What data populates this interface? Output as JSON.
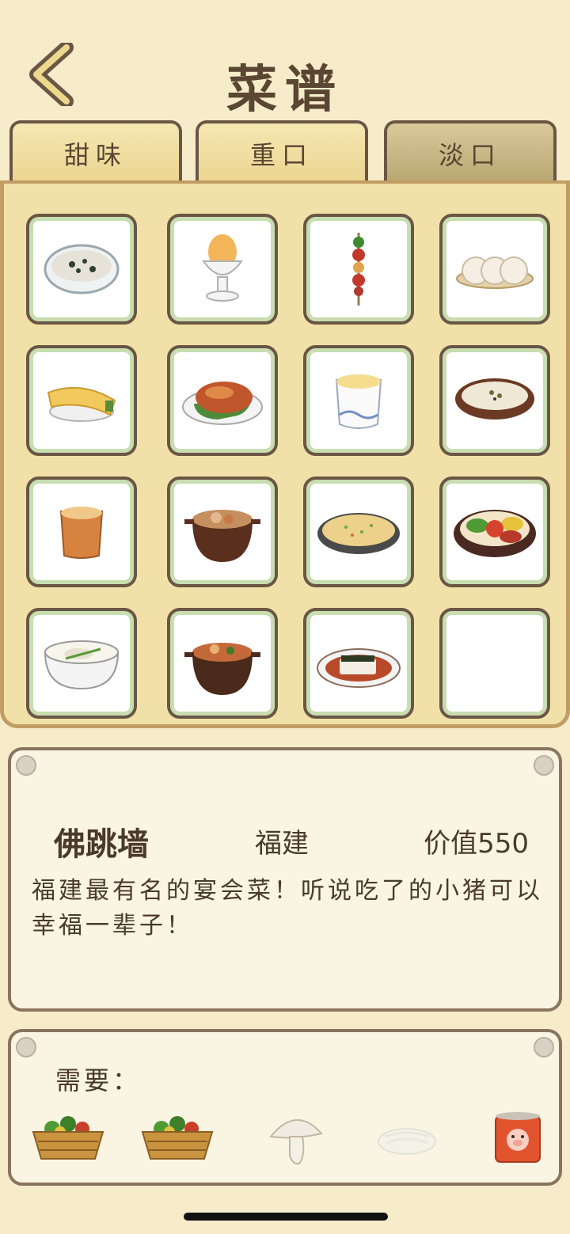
{
  "header": {
    "title": "菜谱",
    "back_icon": "chevron-left-icon"
  },
  "tabs": [
    {
      "label": "甜味",
      "active": false
    },
    {
      "label": "重口",
      "active": false
    },
    {
      "label": "淡口",
      "active": true
    }
  ],
  "recipes": [
    {
      "icon": "congee-bowl-icon"
    },
    {
      "icon": "boiled-egg-cup-icon"
    },
    {
      "icon": "skewer-icon"
    },
    {
      "icon": "rice-cakes-plate-icon"
    },
    {
      "icon": "egg-roll-icon"
    },
    {
      "icon": "roast-duck-icon"
    },
    {
      "icon": "steamed-egg-cup-icon"
    },
    {
      "icon": "soup-bowl-icon"
    },
    {
      "icon": "milk-tea-cup-icon"
    },
    {
      "icon": "claypot-stew-icon"
    },
    {
      "icon": "fried-rice-icon"
    },
    {
      "icon": "bibimbap-icon"
    },
    {
      "icon": "fish-soup-pot-icon"
    },
    {
      "icon": "spicy-claypot-icon"
    },
    {
      "icon": "tofu-dish-icon"
    },
    {
      "icon": "empty-slot"
    }
  ],
  "detail": {
    "name": "佛跳墙",
    "origin": "福建",
    "value": "价值550",
    "description": "福建最有名的宴会菜！听说吃了的小猪可以幸福一辈子！"
  },
  "requirements": {
    "label": "需要：",
    "ingredients": [
      {
        "icon": "vegetable-basket-icon",
        "available": true
      },
      {
        "icon": "vegetable-basket-icon",
        "available": true
      },
      {
        "icon": "mushroom-icon",
        "available": true
      },
      {
        "icon": "noodles-icon",
        "available": false
      },
      {
        "icon": "pig-can-icon",
        "available": true
      }
    ]
  },
  "colors": {
    "background": "#f6ecca",
    "panel": "#f1e1a8",
    "border": "#6a5644",
    "text": "#4a3a2a",
    "active_tab": "#b8a672"
  }
}
